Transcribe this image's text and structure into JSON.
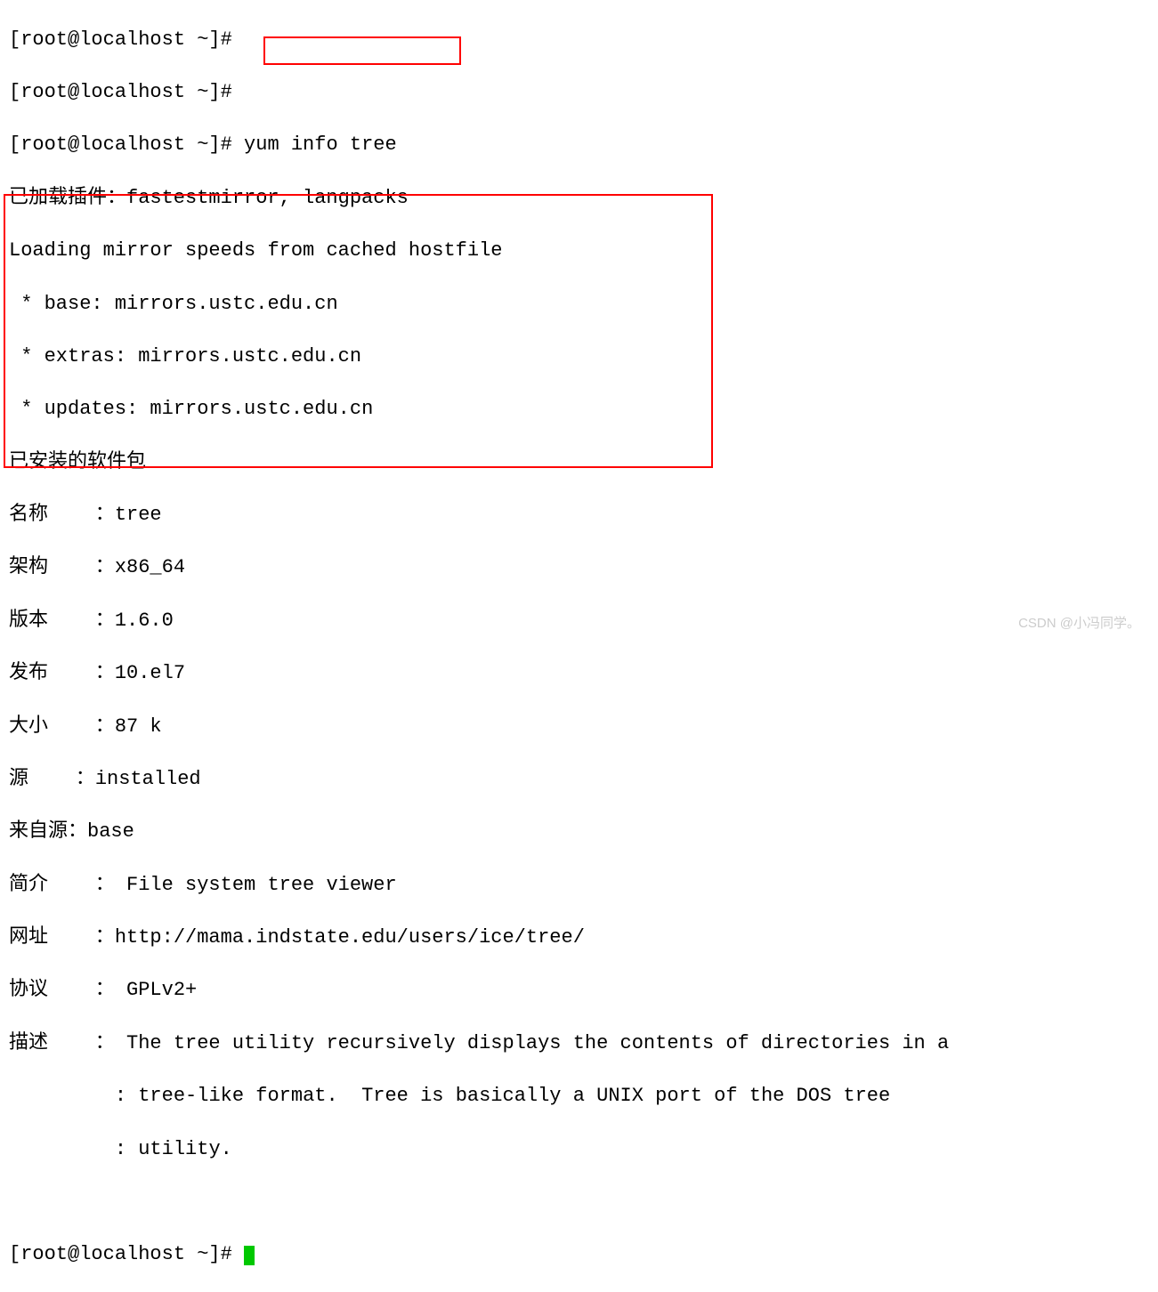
{
  "terminal": {
    "line_broken_top": "[root@localhost ~]#",
    "prompt_empty": "[root@localhost ~]#",
    "prompt_cmd": "[root@localhost ~]# ",
    "command": "yum info tree",
    "plugins_line": "已加载插件：fastestmirror, langpacks",
    "loading_line": "Loading mirror speeds from cached hostfile",
    "mirror_base": " * base: mirrors.ustc.edu.cn",
    "mirror_extras": " * extras: mirrors.ustc.edu.cn",
    "mirror_updates": " * updates: mirrors.ustc.edu.cn",
    "installed_header": "已安装的软件包",
    "fields": {
      "name_label": "名称    ：",
      "name_value": "tree",
      "arch_label": "架构    ：",
      "arch_value": "x86_64",
      "version_label": "版本    ：",
      "version_value": "1.6.0",
      "release_label": "发布    ：",
      "release_value": "10.el7",
      "size_label": "大小    ：",
      "size_value": "87 k",
      "repo_label": "源    ：",
      "repo_value": "installed",
      "from_repo_label": "来自源：",
      "from_repo_value": "base",
      "summary_label": "简介    ： ",
      "summary_value": "File system tree viewer",
      "url_label": "网址    ：",
      "url_value": "http://mama.indstate.edu/users/ice/tree/",
      "license_label": "协议    ： ",
      "license_value": "GPLv2+",
      "desc_label": "描述    ： ",
      "desc_line1": "The tree utility recursively displays the contents of directories in a",
      "desc_cont": "         : ",
      "desc_line2": "tree-like format.  Tree is basically a UNIX port of the DOS tree",
      "desc_line3": "utility."
    },
    "final_prompt": "[root@localhost ~]# "
  },
  "watermark": "CSDN @小冯同学。"
}
